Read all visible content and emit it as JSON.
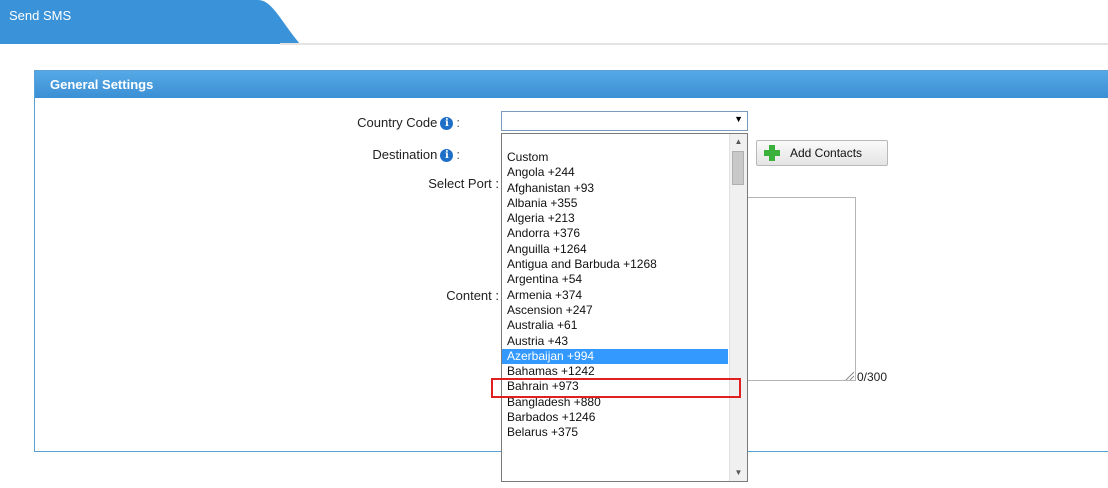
{
  "tab": {
    "title": "Send SMS"
  },
  "panel": {
    "title": "General Settings"
  },
  "form": {
    "country_code_label": "Country Code",
    "destination_label": "Destination",
    "select_port_label": "Select Port :",
    "content_label": "Content :",
    "colon": ":",
    "add_contacts_label": "Add Contacts",
    "char_counter": "0/300",
    "country_code_value": ""
  },
  "dropdown": {
    "options": [
      "Custom",
      "Angola +244",
      "Afghanistan +93",
      "Albania +355",
      "Algeria +213",
      "Andorra +376",
      "Anguilla +1264",
      "Antigua and Barbuda +1268",
      "Argentina +54",
      "Armenia +374",
      "Ascension +247",
      "Australia +61",
      "Austria +43",
      "Azerbaijan +994",
      "Bahamas +1242",
      "Bahrain +973",
      "Bangladesh +880",
      "Barbados +1246",
      "Belarus +375"
    ],
    "selected_index": 13
  },
  "colors": {
    "tab_blue": "#3a93d8",
    "header_blue": "#3b8fd4",
    "selection_blue": "#3399ff",
    "highlight_red": "#e02020",
    "add_icon_green": "#3ab13a"
  },
  "icons": {
    "info": "info-icon",
    "add": "plus-icon",
    "dropdown": "chevron-down-icon"
  }
}
